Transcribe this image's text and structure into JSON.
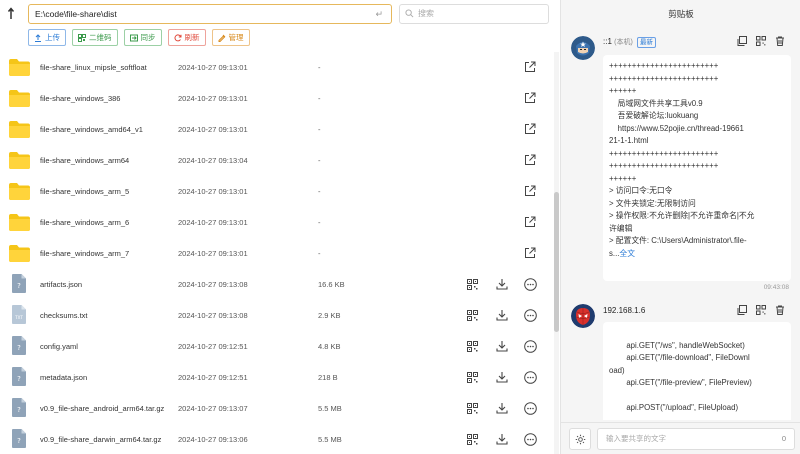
{
  "toolbar": {
    "path": "E:\\code\\file-share\\dist",
    "search_placeholder": "搜索",
    "actions": [
      {
        "label": "上传",
        "color": "blue",
        "icon": "upload-icon"
      },
      {
        "label": "二维码",
        "color": "green",
        "icon": "qrcode-icon"
      },
      {
        "label": "同步",
        "color": "green",
        "icon": "sync-icon"
      },
      {
        "label": "刷新",
        "color": "red",
        "icon": "refresh-icon"
      },
      {
        "label": "管理",
        "color": "orange",
        "icon": "manage-icon"
      }
    ]
  },
  "files": [
    {
      "name": "file-share_linux_mipsle_softfloat",
      "date": "2024-10-27 09:13:01",
      "size": "-",
      "type": "folder"
    },
    {
      "name": "file-share_windows_386",
      "date": "2024-10-27 09:13:01",
      "size": "-",
      "type": "folder"
    },
    {
      "name": "file-share_windows_amd64_v1",
      "date": "2024-10-27 09:13:01",
      "size": "-",
      "type": "folder"
    },
    {
      "name": "file-share_windows_arm64",
      "date": "2024-10-27 09:13:04",
      "size": "-",
      "type": "folder"
    },
    {
      "name": "file-share_windows_arm_5",
      "date": "2024-10-27 09:13:01",
      "size": "-",
      "type": "folder"
    },
    {
      "name": "file-share_windows_arm_6",
      "date": "2024-10-27 09:13:01",
      "size": "-",
      "type": "folder"
    },
    {
      "name": "file-share_windows_arm_7",
      "date": "2024-10-27 09:13:01",
      "size": "-",
      "type": "folder"
    },
    {
      "name": "artifacts.json",
      "date": "2024-10-27 09:13:08",
      "size": "16.6 KB",
      "type": "file",
      "icon_label": "?"
    },
    {
      "name": "checksums.txt",
      "date": "2024-10-27 09:13:08",
      "size": "2.9 KB",
      "type": "file",
      "icon_label": "TXT"
    },
    {
      "name": "config.yaml",
      "date": "2024-10-27 09:12:51",
      "size": "4.8 KB",
      "type": "file",
      "icon_label": "?"
    },
    {
      "name": "metadata.json",
      "date": "2024-10-27 09:12:51",
      "size": "218 B",
      "type": "file",
      "icon_label": "?"
    },
    {
      "name": "v0.9_file-share_android_arm64.tar.gz",
      "date": "2024-10-27 09:13:07",
      "size": "5.5 MB",
      "type": "file",
      "icon_label": "?"
    },
    {
      "name": "v0.9_file-share_darwin_arm64.tar.gz",
      "date": "2024-10-27 09:13:06",
      "size": "5.5 MB",
      "type": "file",
      "icon_label": "?"
    }
  ],
  "clipboard": {
    "title": "剪贴板",
    "messages": [
      {
        "sender": "::1",
        "tag": "(本机)",
        "badge": "最新",
        "lines": [
          "++++++++++++++++++++++++",
          "++++++++++++++++++++++++",
          "++++++",
          "    局域网文件共享工具v0.9",
          "    吾爱破解论坛:luokuang",
          "    https://www.52pojie.cn/thread-19661",
          "21-1-1.html",
          "++++++++++++++++++++++++",
          "++++++++++++++++++++++++",
          "++++++",
          "> 访问口令:无口令",
          "> 文件夹锁定:无限制访问",
          "> 操作权限:不允许删除|不允许重命名|不允",
          "许编辑",
          "> 配置文件: C:\\Users\\Administrator\\.file-",
          "s..."
        ],
        "more": "全文",
        "time": "09:43:08"
      },
      {
        "sender": "192.168.1.6",
        "lines": [
          "",
          "        api.GET(\"/ws\", handleWebSocket)",
          "        api.GET(\"/file-download\", FileDownl",
          "oad)",
          "        api.GET(\"/file-preview\", FilePreview)",
          "",
          "        api.POST(\"/upload\", FileUpload)"
        ]
      }
    ],
    "input_placeholder": "输入要共享的文字",
    "count": "0"
  }
}
